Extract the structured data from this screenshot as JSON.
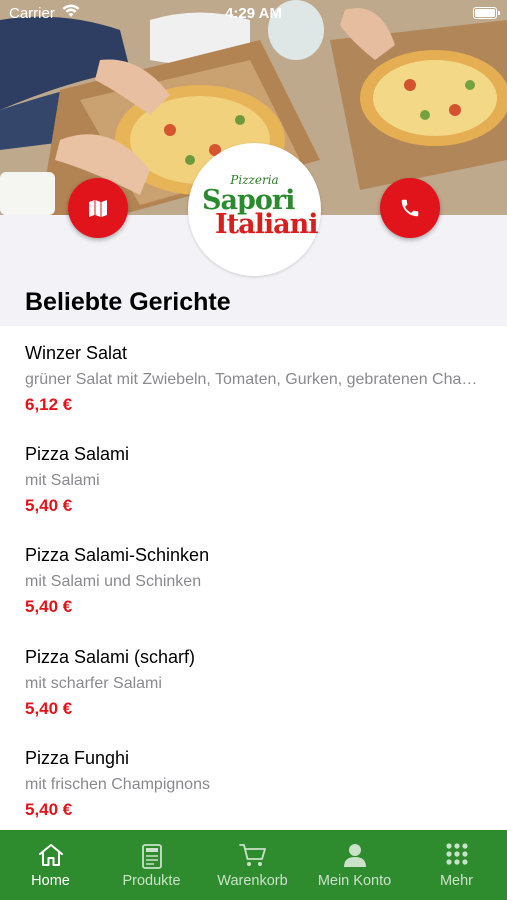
{
  "status_bar": {
    "carrier": "Carrier",
    "time": "4:29 AM"
  },
  "logo": {
    "line1": "Pizzeria",
    "line2": "Sapori",
    "line3": "Italiani"
  },
  "section_title": "Beliebte Gerichte",
  "items": [
    {
      "name": "Winzer Salat",
      "desc": "grüner Salat mit Zwiebeln, Tomaten, Gurken, gebratenen Champignons",
      "price": "6,12 €"
    },
    {
      "name": "Pizza Salami",
      "desc": "mit Salami",
      "price": "5,40 €"
    },
    {
      "name": "Pizza Salami-Schinken",
      "desc": "mit Salami und Schinken",
      "price": "5,40 €"
    },
    {
      "name": "Pizza Salami (scharf)",
      "desc": "mit scharfer Salami",
      "price": "5,40 €"
    },
    {
      "name": "Pizza Funghi",
      "desc": "mit frischen Champignons",
      "price": "5,40 €"
    }
  ],
  "tabs": [
    {
      "label": "Home",
      "icon": "home-icon",
      "active": true
    },
    {
      "label": "Produkte",
      "icon": "menu-card-icon",
      "active": false
    },
    {
      "label": "Warenkorb",
      "icon": "cart-icon",
      "active": false
    },
    {
      "label": "Mein Konto",
      "icon": "person-icon",
      "active": false
    },
    {
      "label": "Mehr",
      "icon": "grid-icon",
      "active": false
    }
  ],
  "colors": {
    "accent_red": "#e1141c",
    "tab_green": "#2e8b2e",
    "logo_green": "#2b8a2f"
  }
}
